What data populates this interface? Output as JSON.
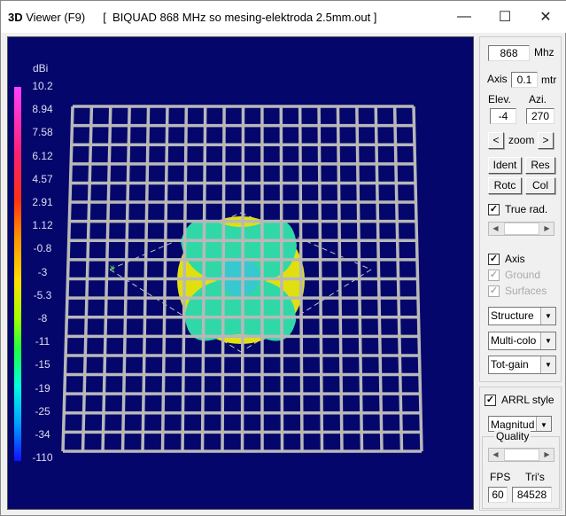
{
  "window": {
    "title_bold": "3D",
    "title": " Viewer (F9)",
    "file": "[  BIQUAD 868 MHz so mesing-elektroda 2.5mm.out ]"
  },
  "scale": {
    "unit": "dBi",
    "ticks": [
      "10.2",
      "8.94",
      "7.58",
      "6.12",
      "4.57",
      "2.91",
      "1.12",
      "-0.8",
      "-3",
      "-5.3",
      "-8",
      "-11",
      "-15",
      "-19",
      "-25",
      "-34",
      "-110"
    ]
  },
  "panel": {
    "freq": "868",
    "freq_unit": "Mhz",
    "axis_label": "Axis",
    "axis": "0.1",
    "axis_unit": "mtr",
    "elev_label": "Elev.",
    "azi_label": "Azi.",
    "elev": "-4",
    "azi": "270",
    "zoom_left": "<",
    "zoom_label": "zoom",
    "zoom_right": ">",
    "ident": "Ident",
    "res": "Res",
    "rotc": "Rotc",
    "col": "Col",
    "true_rad": "True rad.",
    "axis_chk": "Axis",
    "ground": "Ground",
    "surfaces": "Surfaces",
    "combo1": "Structure",
    "combo2": "Multi-colo",
    "combo3": "Tot-gain",
    "arrl": "ARRL style",
    "combo4": "Magnitud",
    "quality": "Quality",
    "fps_label": "FPS",
    "tris_label": "Tri's",
    "fps": "60",
    "tris": "84528"
  }
}
